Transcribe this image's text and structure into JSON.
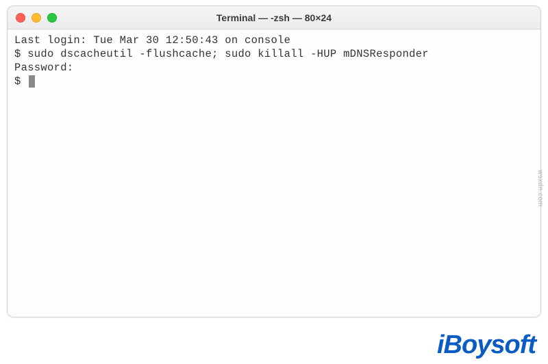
{
  "window": {
    "title": "Terminal — -zsh — 80×24"
  },
  "terminal": {
    "lines": {
      "last_login": "Last login: Tue Mar 30 12:50:43 on console",
      "command": "$ sudo dscacheutil -flushcache; sudo killall -HUP mDNSResponder",
      "password_prompt": "Password:",
      "prompt": "$ "
    }
  },
  "watermark": {
    "text": "iBoysoft"
  },
  "source": {
    "text": "wsxdn.com"
  }
}
